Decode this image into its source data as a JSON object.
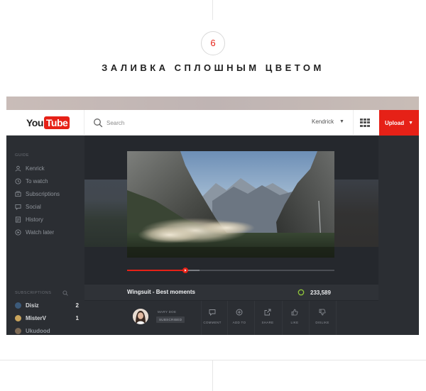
{
  "step": {
    "number": "6"
  },
  "heading": "ЗАЛИВКА СПЛОШНЫМ ЦВЕТОМ",
  "header": {
    "logo_you": "You",
    "logo_tube": "Tube",
    "search_placeholder": "Search",
    "username": "Kendrick",
    "upload_label": "Upload"
  },
  "sidebar": {
    "guide_label": "GUIDE",
    "items": [
      {
        "label": "Kenrick",
        "icon": "user-icon"
      },
      {
        "label": "To watch",
        "icon": "clock-icon"
      },
      {
        "label": "Subscriptions",
        "icon": "subscriptions-icon"
      },
      {
        "label": "Social",
        "icon": "social-icon"
      },
      {
        "label": "History",
        "icon": "history-icon"
      },
      {
        "label": "Watch later",
        "icon": "play-circle-icon"
      }
    ],
    "subscriptions_label": "SUBSCRIPTIONS",
    "subscriptions": [
      {
        "name": "Disiz",
        "count": "2",
        "color": "#3c5a7a"
      },
      {
        "name": "MisterV",
        "count": "1",
        "color": "#c9a45c"
      },
      {
        "name": "Ukudood",
        "count": "",
        "color": "#7d6a55"
      }
    ]
  },
  "video": {
    "title": "Wingsuit - Best moments",
    "views": "233,589",
    "progress": 0.28,
    "buffered": 0.35
  },
  "channel": {
    "name": "MARY DOE",
    "subscribed_label": "SUBSCRIBED"
  },
  "actions": [
    {
      "label": "COMMENT",
      "icon": "comment-icon"
    },
    {
      "label": "ADD TO",
      "icon": "add-icon"
    },
    {
      "label": "SHARE",
      "icon": "share-icon"
    },
    {
      "label": "LIKE",
      "icon": "thumbs-up-icon"
    },
    {
      "label": "DISLIKE",
      "icon": "thumbs-down-icon"
    }
  ],
  "colors": {
    "accent": "#e62117",
    "dark_bg": "#25282d",
    "views_ring": "#8fc43a"
  }
}
